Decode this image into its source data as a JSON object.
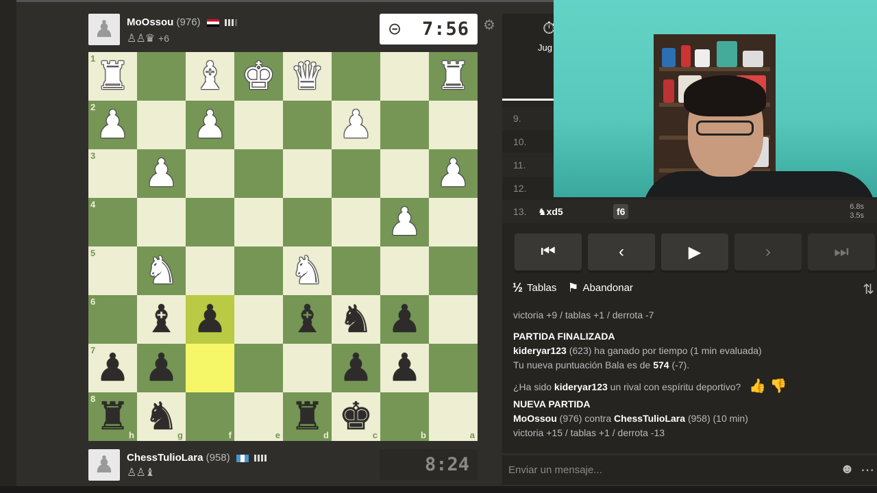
{
  "top_player": {
    "name": "MoOssou",
    "rating": "(976)",
    "captured": "♙♙♛",
    "advantage": "+6",
    "clock": "7:56",
    "clock_icon": "⊝"
  },
  "bottom_player": {
    "name": "ChessTulioLara",
    "rating": "(958)",
    "captured": "♙♙♝",
    "clock": "8:24"
  },
  "board": {
    "ranks": [
      "1",
      "2",
      "3",
      "4",
      "5",
      "6",
      "7",
      "8"
    ],
    "files": [
      "h",
      "g",
      "f",
      "e",
      "d",
      "c",
      "b",
      "a"
    ],
    "rows": [
      [
        "wR",
        "",
        "wB",
        "wK",
        "wQ",
        "",
        "",
        "wR"
      ],
      [
        "wP",
        "",
        "wP",
        "",
        "",
        "wP",
        "",
        ""
      ],
      [
        "",
        "wP",
        "",
        "",
        "",
        "",
        "",
        "wP"
      ],
      [
        "",
        "",
        "",
        "",
        "",
        "",
        "wP",
        ""
      ],
      [
        "",
        "wN",
        "",
        "",
        "wN",
        "",
        "",
        ""
      ],
      [
        "",
        "bB",
        "bP",
        "",
        "bB",
        "bN",
        "bP",
        ""
      ],
      [
        "bP",
        "bP",
        "",
        "",
        "",
        "bP",
        "bP",
        ""
      ],
      [
        "bR",
        "bN",
        "",
        "",
        "bR",
        "bK",
        "",
        ""
      ]
    ],
    "highlight": [
      [
        5,
        2
      ],
      [
        6,
        2
      ]
    ]
  },
  "panel": {
    "tab_label": "Jug",
    "moves": [
      {
        "num": "9.",
        "white": "",
        "black": ""
      },
      {
        "num": "10.",
        "white": "",
        "black": ""
      },
      {
        "num": "11.",
        "white": "",
        "black": ""
      },
      {
        "num": "12.",
        "white": "",
        "black": ""
      },
      {
        "num": "13.",
        "white": "♞xd5",
        "black": "f6",
        "time_white": "6.8s",
        "time_black": "3.5s"
      }
    ],
    "nav": [
      "⏮",
      "‹",
      "▶",
      "›",
      "⏭"
    ],
    "draw_icon": "½",
    "draw_label": "Tablas",
    "resign_icon": "⚑",
    "resign_label": "Abandonar",
    "flip_icon": "⇅"
  },
  "chat": {
    "line1": "victoria +9 / tablas +1 / derrota -7",
    "game_over_title": "PARTIDA FINALIZADA",
    "winner": "kideryar123",
    "winner_rest": "(623) ha ganado por tiempo (1 min evaluada)",
    "rating_prefix": "Tu nueva puntuación Bala es de",
    "new_rating": "574",
    "rating_change": "(-7).",
    "sport_q_prefix": "¿Ha sido",
    "sport_q_name": "kideryar123",
    "sport_q_rest": "un rival con espíritu deportivo?",
    "new_game_title": "NUEVA PARTIDA",
    "ng_p1": "MoOssou",
    "ng_p1_rating": "(976) contra",
    "ng_p2": "ChessTulioLara",
    "ng_p2_rating": "(958) (10 min)",
    "line_last": "victoria +15 / tablas +1 / derrota -13"
  },
  "message_placeholder": "Enviar un mensaje..."
}
